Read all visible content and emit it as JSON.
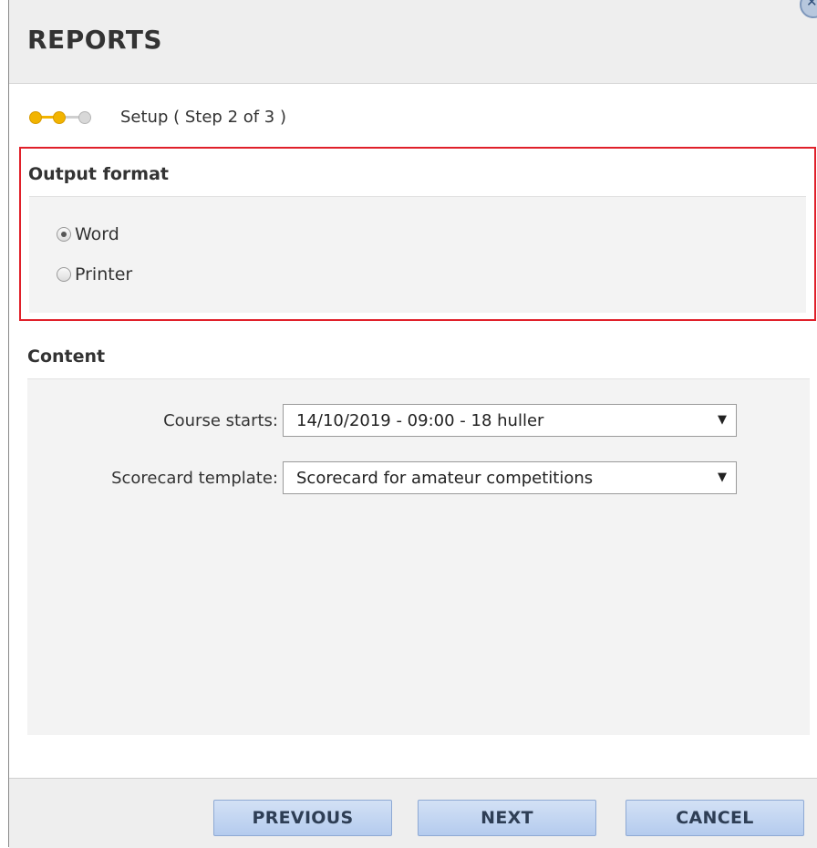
{
  "dialog": {
    "title": "REPORTS",
    "close_icon": "close-icon"
  },
  "step": {
    "text": "Setup ( Step 2 of 3 )",
    "current": 2,
    "total": 3,
    "active_color": "#f2b400"
  },
  "output_format": {
    "title": "Output format",
    "options": [
      {
        "label": "Word",
        "checked": true
      },
      {
        "label": "Printer",
        "checked": false
      }
    ],
    "highlight_color": "#e0202a"
  },
  "content": {
    "title": "Content",
    "course_starts": {
      "label": "Course starts:",
      "value": "14/10/2019 - 09:00 - 18 huller"
    },
    "scorecard_template": {
      "label": "Scorecard template:",
      "value": "Scorecard for amateur competitions"
    }
  },
  "footer": {
    "previous_label": "PREVIOUS",
    "next_label": "NEXT",
    "cancel_label": "CANCEL"
  }
}
